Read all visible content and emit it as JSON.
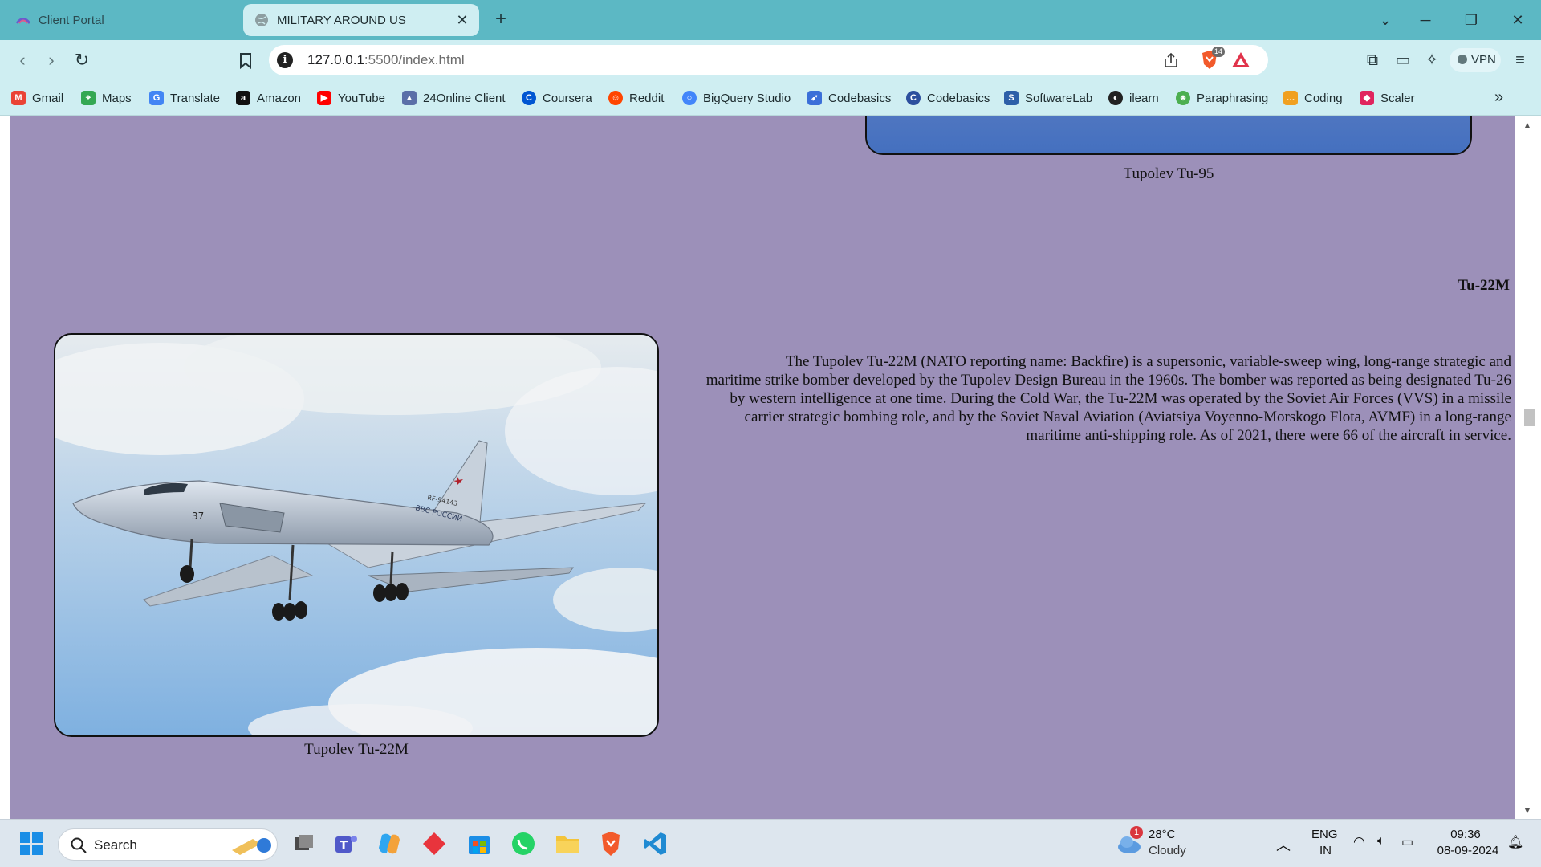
{
  "browser": {
    "tabs": [
      {
        "label": "Client Portal",
        "active": false
      },
      {
        "label": "MILITARY AROUND US",
        "active": true
      }
    ],
    "new_tab_label": "+",
    "url_host": "127.0.0.1",
    "url_path": ":5500/index.html",
    "brave_shield_count": "14",
    "vpn_label": "VPN",
    "bookmarks": [
      {
        "label": "Gmail",
        "icon": "gmail-icon",
        "color": "#ea4335"
      },
      {
        "label": "Maps",
        "icon": "maps-icon",
        "color": "#34a853"
      },
      {
        "label": "Translate",
        "icon": "translate-icon",
        "color": "#4285f4"
      },
      {
        "label": "Amazon",
        "icon": "amazon-icon",
        "color": "#111111"
      },
      {
        "label": "YouTube",
        "icon": "youtube-icon",
        "color": "#ff0000"
      },
      {
        "label": "24Online Client",
        "icon": "24online-icon",
        "color": "#5b6fa8"
      },
      {
        "label": "Coursera",
        "icon": "coursera-icon",
        "color": "#0056d2"
      },
      {
        "label": "Reddit",
        "icon": "reddit-icon",
        "color": "#ff4500"
      },
      {
        "label": "BigQuery Studio",
        "icon": "bigquery-icon",
        "color": "#4386fa"
      },
      {
        "label": "Codebasics",
        "icon": "codebasics-rocket-icon",
        "color": "#3a6fd8"
      },
      {
        "label": "Codebasics",
        "icon": "codebasics-c-icon",
        "color": "#2c4f9e"
      },
      {
        "label": "SoftwareLab",
        "icon": "softwarelab-icon",
        "color": "#2d5fa8"
      },
      {
        "label": "ilearn",
        "icon": "ilearn-icon",
        "color": "#222222"
      },
      {
        "label": "Paraphrasing",
        "icon": "paraphrasing-icon",
        "color": "#4caf50"
      },
      {
        "label": "Coding",
        "icon": "coding-icon",
        "color": "#f0a020"
      },
      {
        "label": "Scaler",
        "icon": "scaler-icon",
        "color": "#e0245e"
      }
    ]
  },
  "page": {
    "previous_caption": "Tupolev Tu-95",
    "section_title": "Tu-22M",
    "image_caption": "Tupolev Tu-22M",
    "description": "The Tupolev Tu-22M (NATO reporting name: Backfire) is a supersonic, variable-sweep wing, long-range strategic and maritime strike bomber developed by the Tupolev Design Bureau in the 1960s. The bomber was reported as being designated Tu-26 by western intelligence at one time. During the Cold War, the Tu-22M was operated by the Soviet Air Forces (VVS) in a missile carrier strategic bombing role, and by the Soviet Naval Aviation (Aviatsiya Voyenno-Morskogo Flota, AVMF) in a long-range maritime anti-shipping role. As of 2021, there were 66 of the aircraft in service.",
    "background_color": "#9c90b9",
    "aircraft_markings": {
      "number": "37",
      "registration": "RF-94143",
      "text": "ВВС РОССИИ"
    }
  },
  "taskbar": {
    "search_label": "Search",
    "weather_badge": "1",
    "weather_temp": "28°C",
    "weather_condition": "Cloudy",
    "language_top": "ENG",
    "language_bottom": "IN",
    "time": "09:36",
    "date": "08-09-2024"
  }
}
